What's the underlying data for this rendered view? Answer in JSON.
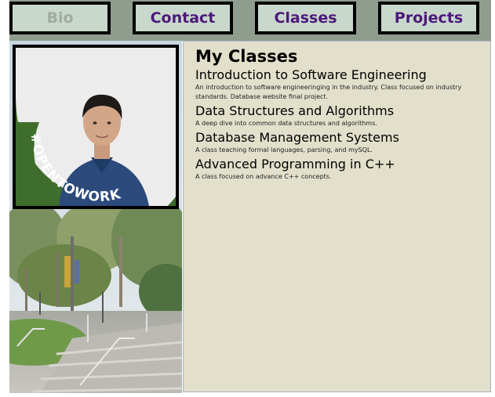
{
  "nav": {
    "items": [
      {
        "label": "Bio",
        "active": false
      },
      {
        "label": "Contact",
        "active": false
      },
      {
        "label": "Classes",
        "active": true
      },
      {
        "label": "Projects",
        "active": false
      }
    ]
  },
  "profile": {
    "badge_text": "#OPENTOWORK"
  },
  "main": {
    "title": "My Classes",
    "classes": [
      {
        "name": "Introduction to Software Engineering",
        "description": "An introduction to software engineeringing in the industry. Class focused on industry standards. Database website final project."
      },
      {
        "name": "Data Structures and Algorithms",
        "description": "A deep dive into common data structures and algorithms."
      },
      {
        "name": "Database Management Systems",
        "description": "A class teaching formal languages, parsing, and mySQL."
      },
      {
        "name": "Advanced Programming in C++",
        "description": "A class focused on advance C++ concepts."
      }
    ]
  },
  "colors": {
    "nav_background": "#8f9d8f",
    "button_background": "#c9d8cc",
    "button_text": "#4c1a7a",
    "button_text_inactive": "#a0aba2",
    "content_background": "#e2e0cb",
    "badge_green": "#3f6d2c"
  }
}
